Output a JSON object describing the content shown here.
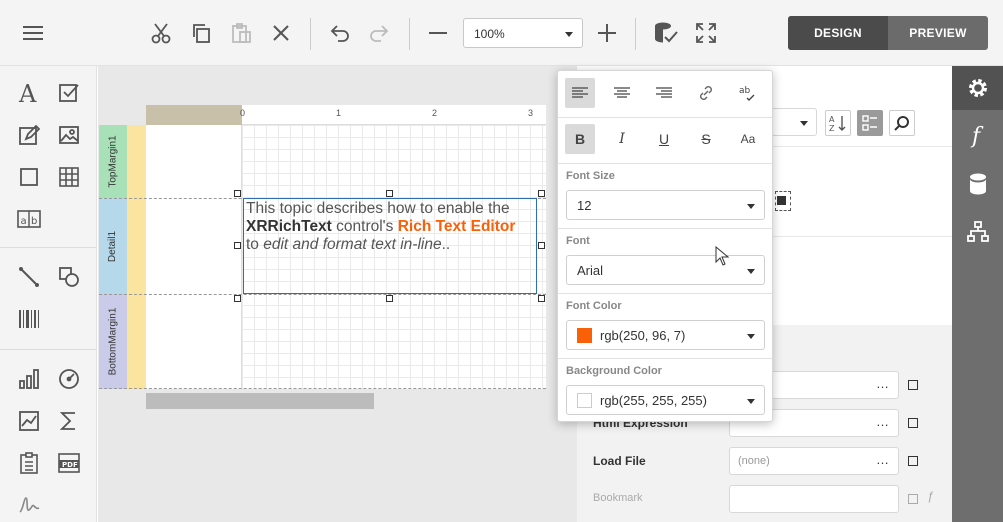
{
  "toolbar": {
    "zoom_value": "100%",
    "design_label": "DESIGN",
    "preview_label": "PREVIEW"
  },
  "bands": [
    "TopMargin1",
    "Detail1",
    "BottomMargin1"
  ],
  "ruler": [
    "0",
    "1",
    "2",
    "3"
  ],
  "rich_text": {
    "part1": "This topic describes how to enable the",
    "bold": "XRRichText",
    "part2": " control's ",
    "accent": "Rich Text Editor",
    "part3": "to ",
    "italic": "edit and format text in-line",
    "part4": ".."
  },
  "colors": {
    "accent": "#fa6007",
    "selection_border": "#2f6fb0",
    "font_color": "#fa6007",
    "background_color": "#ffffff"
  },
  "popup": {
    "font_size_label": "Font Size",
    "font_size_value": "12",
    "font_label": "Font",
    "font_value": "Arial",
    "font_color_label": "Font Color",
    "font_color_value": "rgb(250, 96, 7)",
    "bg_color_label": "Background Color",
    "bg_color_value": "rgb(255, 255, 255)",
    "case_label": "Aa",
    "spell_label": "ab"
  },
  "props": {
    "expression_label": "Html Expression",
    "load_file_label": "Load File",
    "load_file_value": "(none)",
    "bookmark_label": "Bookmark",
    "dots": "…"
  },
  "icons": [
    "menu-icon",
    "cut-icon",
    "copy-icon",
    "paste-icon",
    "delete-icon",
    "undo-icon",
    "redo-icon",
    "zoom-out-icon",
    "zoom-in-icon",
    "validate-icon",
    "fullscreen-icon",
    "gear-icon",
    "function-icon",
    "database-icon",
    "hierarchy-icon"
  ]
}
